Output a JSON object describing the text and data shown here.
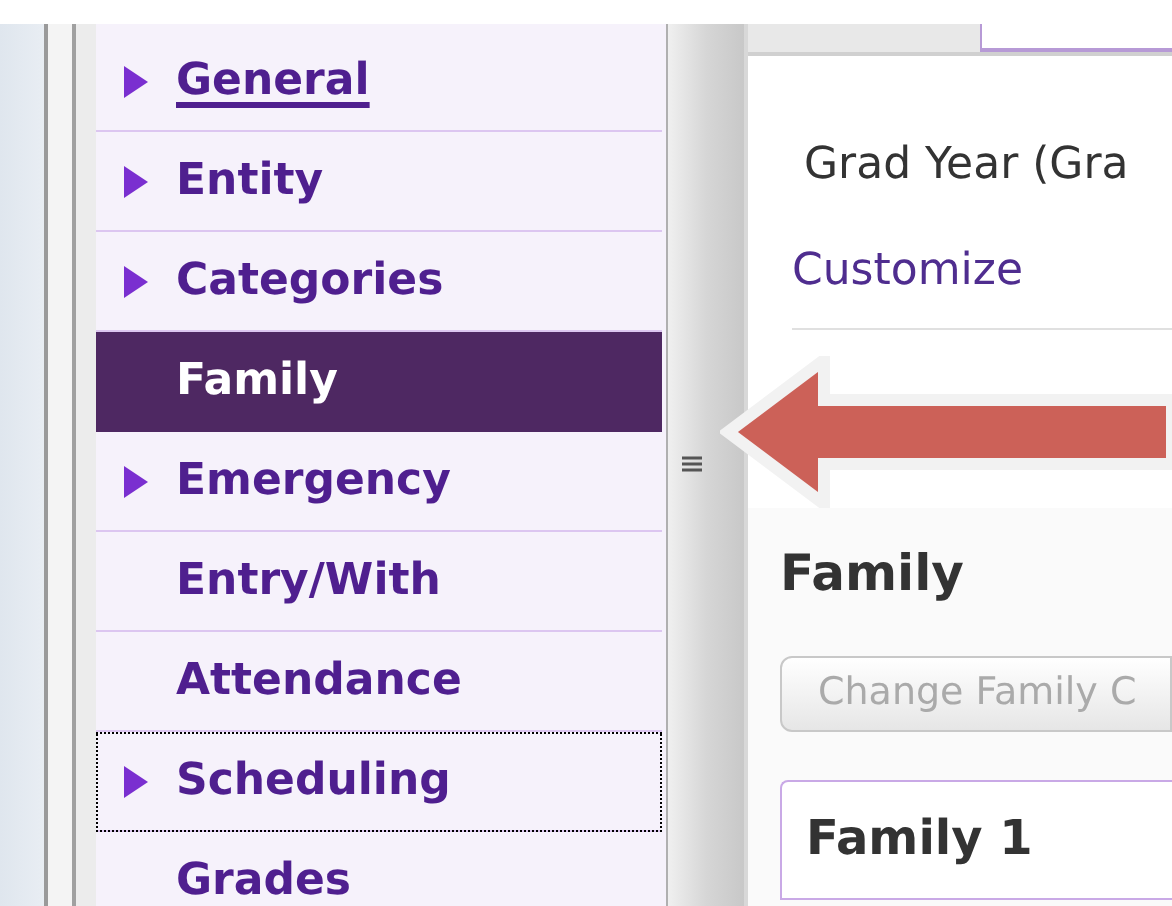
{
  "sidebar": {
    "items": [
      {
        "label": "General",
        "expandable": true,
        "selected": false,
        "focused": false,
        "underlined": true
      },
      {
        "label": "Entity",
        "expandable": true,
        "selected": false,
        "focused": false,
        "underlined": false
      },
      {
        "label": "Categories",
        "expandable": true,
        "selected": false,
        "focused": false,
        "underlined": false
      },
      {
        "label": "Family",
        "expandable": false,
        "selected": true,
        "focused": false,
        "underlined": false
      },
      {
        "label": "Emergency",
        "expandable": true,
        "selected": false,
        "focused": false,
        "underlined": false
      },
      {
        "label": "Entry/With",
        "expandable": false,
        "selected": false,
        "focused": false,
        "underlined": false
      },
      {
        "label": "Attendance",
        "expandable": false,
        "selected": false,
        "focused": false,
        "underlined": false
      },
      {
        "label": "Scheduling",
        "expandable": true,
        "selected": false,
        "focused": true,
        "underlined": false
      },
      {
        "label": "Grades",
        "expandable": false,
        "selected": false,
        "focused": false,
        "underlined": false
      }
    ]
  },
  "content": {
    "field_label": "Grad Year (Gra",
    "customize_link": "Customize",
    "section_title": "Family",
    "change_button": "Change Family C",
    "card_title": "Family 1"
  }
}
